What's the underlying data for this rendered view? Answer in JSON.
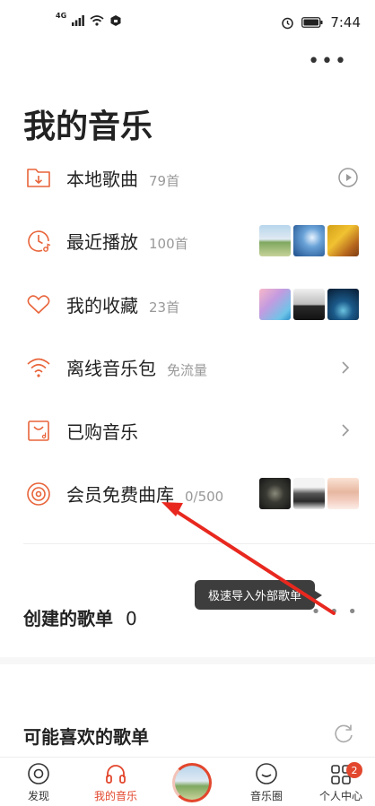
{
  "status_bar": {
    "network": "4G",
    "time": "7:44"
  },
  "page": {
    "title": "我的音乐"
  },
  "menu": [
    {
      "label": "本地歌曲",
      "count": "79首",
      "icon": "folder-download-icon",
      "trailing": "play-circle-icon"
    },
    {
      "label": "最近播放",
      "count": "100首",
      "icon": "recent-clock-icon",
      "trailing": "thumbnails"
    },
    {
      "label": "我的收藏",
      "count": "23首",
      "icon": "heart-icon",
      "trailing": "thumbnails"
    },
    {
      "label": "离线音乐包",
      "count": "免流量",
      "icon": "wifi-icon",
      "trailing": "chevron-right-icon"
    },
    {
      "label": "已购音乐",
      "count": "",
      "icon": "purchased-bag-icon",
      "trailing": "chevron-right-icon"
    },
    {
      "label": "会员免费曲库",
      "count": "0/500",
      "icon": "vinyl-icon",
      "trailing": "thumbnails"
    }
  ],
  "tooltip": {
    "text": "极速导入外部歌单"
  },
  "sections": {
    "created_title": "创建的歌单",
    "created_count": "0",
    "maybe_like_title": "可能喜欢的歌单"
  },
  "tabs": [
    {
      "label": "发现",
      "icon": "discover-icon",
      "active": false
    },
    {
      "label": "我的音乐",
      "icon": "headphones-icon",
      "active": true
    },
    {
      "label": "",
      "icon": "now-playing-cover",
      "active": false
    },
    {
      "label": "音乐圈",
      "icon": "music-circle-icon",
      "active": false
    },
    {
      "label": "个人中心",
      "icon": "grid-icon",
      "active": false,
      "badge": "2"
    }
  ],
  "colors": {
    "accent": "#e2472d",
    "icon_orange": "#e8643a",
    "text_primary": "#222222",
    "text_secondary": "#999999",
    "arrow": "#e8281f"
  }
}
